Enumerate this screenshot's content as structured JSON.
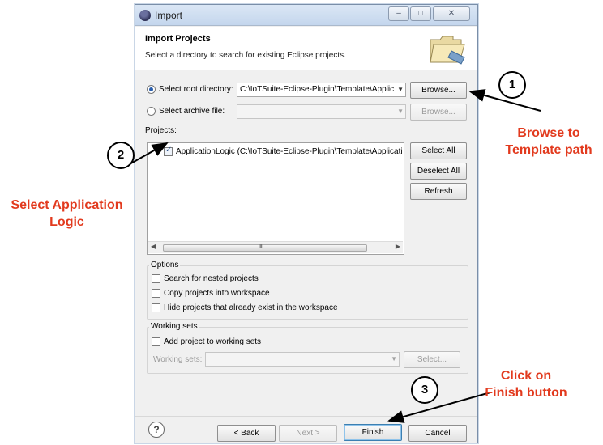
{
  "window": {
    "title": "Import"
  },
  "header": {
    "title": "Import Projects",
    "description": "Select a directory to search for existing Eclipse projects."
  },
  "source": {
    "root_label": "Select root directory:",
    "root_value": "C:\\IoTSuite-Eclipse-Plugin\\Template\\Applic",
    "archive_label": "Select archive file:",
    "archive_value": "",
    "browse_label": "Browse..."
  },
  "projects": {
    "label": "Projects:",
    "items": [
      {
        "label": "ApplicationLogic (C:\\IoTSuite-Eclipse-Plugin\\Template\\Applicatic",
        "checked": true
      }
    ],
    "scroll_grip": "III",
    "buttons": {
      "select_all": "Select All",
      "deselect_all": "Deselect All",
      "refresh": "Refresh"
    }
  },
  "options": {
    "title": "Options",
    "items": [
      {
        "label": "Search for nested projects",
        "checked": false
      },
      {
        "label": "Copy projects into workspace",
        "checked": false
      },
      {
        "label": "Hide projects that already exist in the workspace",
        "checked": false
      }
    ]
  },
  "working_sets": {
    "title": "Working sets",
    "add_label": "Add project to working sets",
    "sets_label": "Working sets:",
    "select_label": "Select..."
  },
  "footer": {
    "help": "?",
    "back": "< Back",
    "next": "Next >",
    "finish": "Finish",
    "cancel": "Cancel"
  },
  "annotations": {
    "circle1": "1",
    "circle2": "2",
    "circle3": "3",
    "note1_line1": "Browse to",
    "note1_line2": "Template path",
    "note2_line1": "Select Application",
    "note2_line2": "Logic",
    "note3_line1": "Click on",
    "note3_line2": "Finish  button"
  },
  "colors": {
    "annotation_text": "#e23a1e",
    "primary_button_border": "#3c7fb1",
    "radio_dot": "#2a5fae"
  }
}
